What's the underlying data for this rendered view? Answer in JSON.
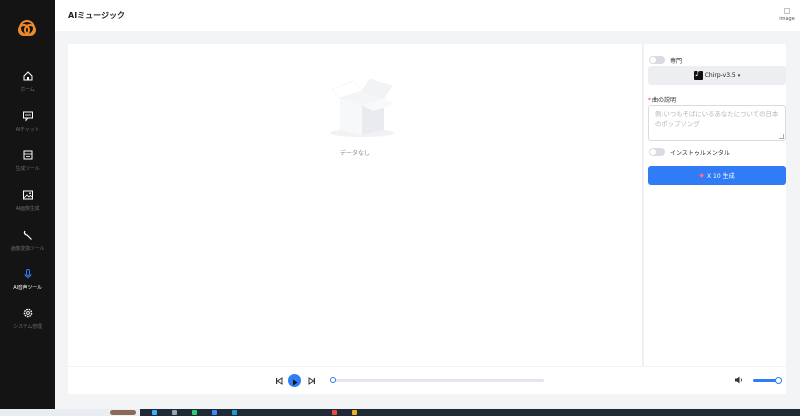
{
  "app": {
    "title": "AIミュージック"
  },
  "header": {
    "image_alt": "image"
  },
  "sidebar": {
    "items": [
      {
        "label": "ホーム",
        "icon": "home-icon"
      },
      {
        "label": "AIチャット",
        "icon": "chat-icon"
      },
      {
        "label": "生成ツール",
        "icon": "tools-icon"
      },
      {
        "label": "AI画像生成",
        "icon": "image-icon"
      },
      {
        "label": "画像変換ツール",
        "icon": "wrench-icon"
      },
      {
        "label": "AI音声ツール",
        "icon": "microphone-icon",
        "active": true
      },
      {
        "label": "システム管理",
        "icon": "gear-icon"
      }
    ]
  },
  "main": {
    "empty_text": "データなし"
  },
  "panel": {
    "mode_label": "専門",
    "mode_enabled": false,
    "model": "Chirp-v3.5",
    "desc_label": "曲の説明",
    "desc_placeholder": "例:いつもそばにいるあなたについての日本のポップソング",
    "instrumental_label": "インストゥルメンタル",
    "instrumental_enabled": false,
    "generate_label": "X 10 生成"
  },
  "player": {
    "progress": 0,
    "volume": 0.8
  },
  "colors": {
    "accent": "#2f7cf6",
    "sidebar_bg": "#141414",
    "logo": "#f08a2c"
  }
}
